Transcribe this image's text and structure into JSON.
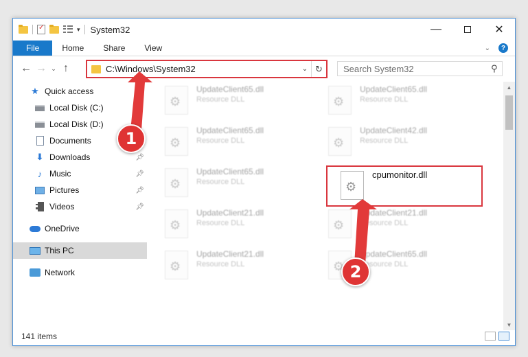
{
  "window": {
    "title": "System32"
  },
  "ribbon": {
    "tabs": [
      "File",
      "Home",
      "Share",
      "View"
    ]
  },
  "address": {
    "path": "C:\\Windows\\System32",
    "search_placeholder": "Search System32"
  },
  "navpane": {
    "quick_access": "Quick access",
    "quick_items": [
      {
        "label": "Local Disk (C:)",
        "icon": "drive-icon",
        "pinned": true
      },
      {
        "label": "Local Disk (D:)",
        "icon": "drive-icon",
        "pinned": true
      },
      {
        "label": "Documents",
        "icon": "documents-icon",
        "pinned": true
      },
      {
        "label": "Downloads",
        "icon": "download-icon",
        "pinned": true
      },
      {
        "label": "Music",
        "icon": "music-icon",
        "pinned": true
      },
      {
        "label": "Pictures",
        "icon": "pictures-icon",
        "pinned": true
      },
      {
        "label": "Videos",
        "icon": "videos-icon",
        "pinned": true
      }
    ],
    "onedrive": "OneDrive",
    "this_pc": "This PC",
    "network": "Network"
  },
  "files": [
    {
      "name": "UpdateClient65.dll",
      "type": "Resource DLL"
    },
    {
      "name": "UpdateClient65.dll",
      "type": "Resource DLL"
    },
    {
      "name": "UpdateClient65.dll",
      "type": "Resource DLL"
    },
    {
      "name": "UpdateClient42.dll",
      "type": "Resource DLL"
    },
    {
      "name": "UpdateClient65.dll",
      "type": "Resource DLL"
    },
    {
      "name": "cpumonitor.dll",
      "type": ""
    },
    {
      "name": "UpdateClient21.dll",
      "type": "Resource DLL"
    },
    {
      "name": "UpdateClient21.dll",
      "type": "Resource DLL"
    },
    {
      "name": "UpdateClient21.dll",
      "type": "Resource DLL"
    },
    {
      "name": "UpdateClient65.dll",
      "type": "Resource DLL"
    }
  ],
  "status": {
    "item_count": "141 items"
  },
  "callouts": {
    "step1": "1",
    "step2": "2",
    "color": "#df3434"
  }
}
